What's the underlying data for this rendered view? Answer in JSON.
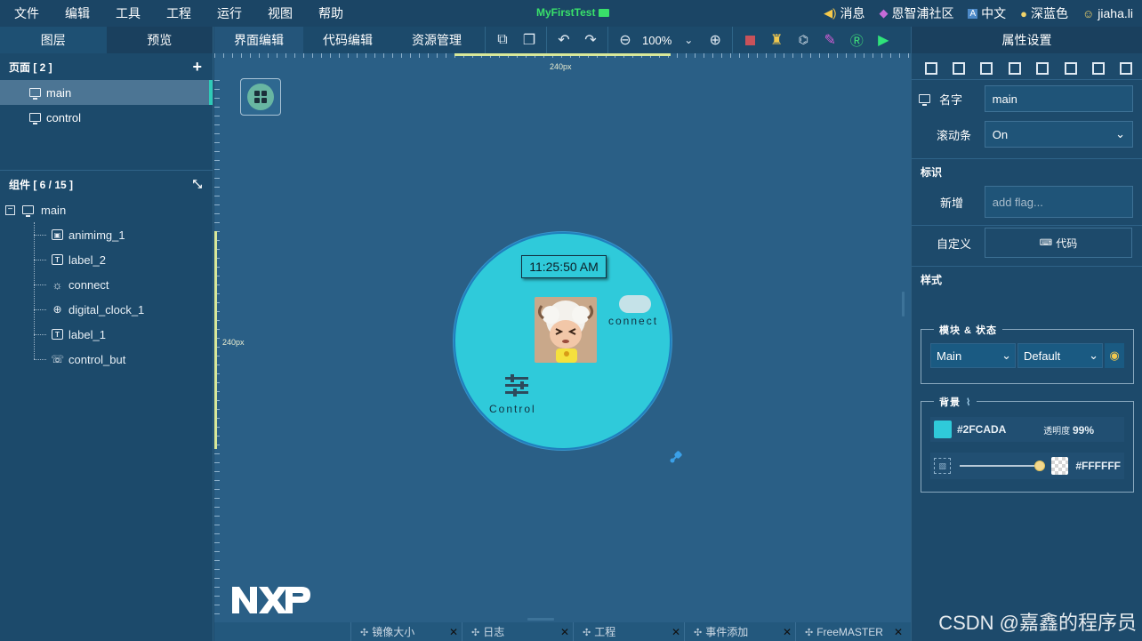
{
  "menu": [
    "文件",
    "编辑",
    "工具",
    "工程",
    "运行",
    "视图",
    "帮助"
  ],
  "project_title": "MyFirstTest",
  "topbar": {
    "message": "消息",
    "community": "恩智浦社区",
    "language": "中文",
    "theme": "深蓝色",
    "user": "jiaha.li"
  },
  "left_tabs": [
    "图层",
    "预览"
  ],
  "pages": {
    "header": "页面 [ 2 ]",
    "items": [
      "main",
      "control"
    ]
  },
  "components": {
    "header": "组件 [ 6 / 15 ]",
    "root": "main",
    "items": [
      {
        "name": "animimg_1",
        "icon": "image-icon"
      },
      {
        "name": "label_2",
        "icon": "text-icon"
      },
      {
        "name": "connect",
        "icon": "sun-icon"
      },
      {
        "name": "digital_clock_1",
        "icon": "clock-icon"
      },
      {
        "name": "label_1",
        "icon": "text-icon"
      },
      {
        "name": "control_but",
        "icon": "button-icon"
      }
    ]
  },
  "toolbar_tabs": [
    "界面编辑",
    "代码编辑",
    "资源管理"
  ],
  "zoom": "100%",
  "ruler": {
    "h_label": "240px",
    "v_label": "240px"
  },
  "screen": {
    "clock_text": "11:25:50 AM",
    "connect_label": "connect",
    "control_label": "Control",
    "logo_text": "NXP",
    "bg_color": "#2FCADA"
  },
  "bottom_tabs": [
    "镜像大小",
    "日志",
    "工程",
    "事件添加",
    "FreeMASTER"
  ],
  "props": {
    "title": "属性设置",
    "name_label": "名字",
    "name_value": "main",
    "scroll_label": "滚动条",
    "scroll_value": "On",
    "flag_section": "标识",
    "add_label": "新增",
    "add_placeholder": "add flag...",
    "custom_label": "自定义",
    "code_button": "代码",
    "style_section": "样式",
    "module_state_legend": "模块 & 状态",
    "module_value": "Main",
    "state_value": "Default",
    "bg_legend": "背景",
    "bg_color_hex": "#2FCADA",
    "opacity_label": "透明度",
    "opacity_value": "99%",
    "image_color_hex": "#FFFFFF"
  },
  "watermark": "CSDN @嘉鑫的程序员"
}
